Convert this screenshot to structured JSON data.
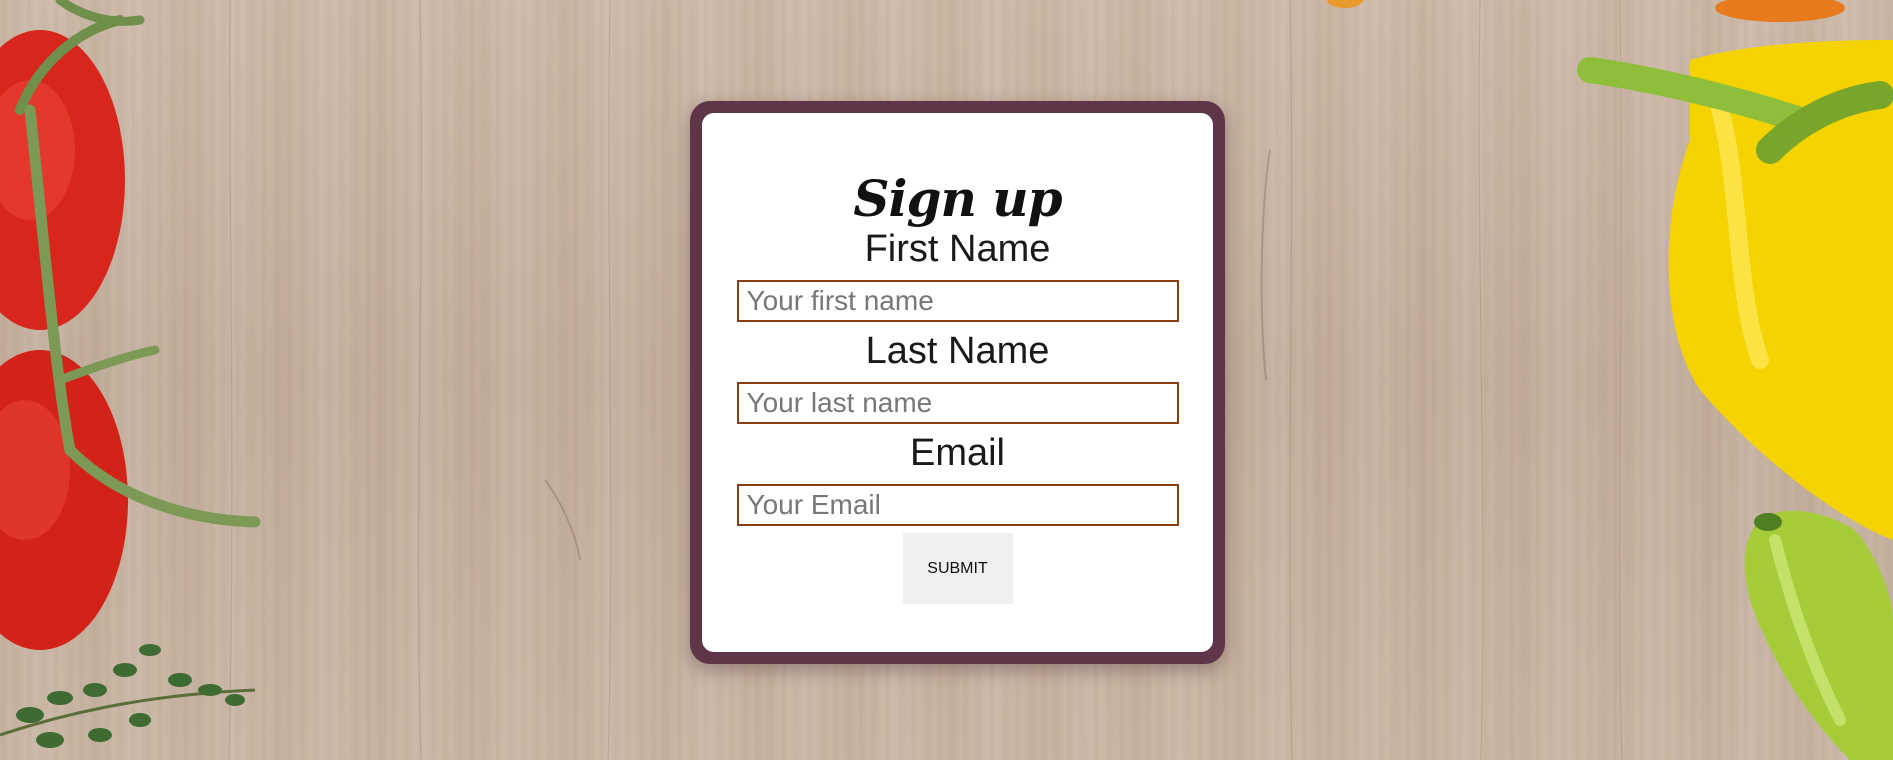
{
  "form": {
    "title": "Sign up",
    "fields": [
      {
        "label": "First Name",
        "placeholder": "Your first name"
      },
      {
        "label": "Last Name",
        "placeholder": "Your last name"
      },
      {
        "label": "Email",
        "placeholder": "Your Email"
      }
    ],
    "submit_label": "SUBMIT"
  },
  "colors": {
    "card_border": "#5f3649",
    "input_border": "#8a3d10",
    "button_bg": "#efefef"
  },
  "background": {
    "decorations": [
      "tomato-vine",
      "thyme-sprig",
      "yellow-bell-pepper",
      "green-pepper"
    ]
  }
}
